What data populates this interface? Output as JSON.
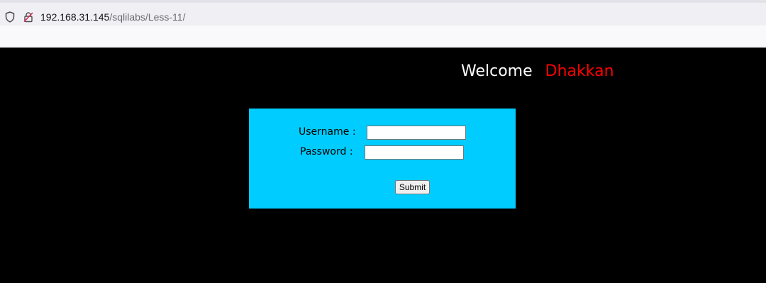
{
  "browser": {
    "url_host": "192.168.31.145",
    "url_path": "/sqlilabs/Less-11/",
    "icons": [
      "shield-icon",
      "lock-icon"
    ]
  },
  "page": {
    "welcome_word": "Welcome",
    "welcome_name": "Dhakkan",
    "colors": {
      "background": "#000000",
      "login_box": "#00ccff",
      "welcome_word": "#ffffff",
      "welcome_name": "#ff0000"
    }
  },
  "form": {
    "username_label": "Username :",
    "password_label": "Password :",
    "username_value": "",
    "password_value": "",
    "submit_label": "Submit"
  }
}
